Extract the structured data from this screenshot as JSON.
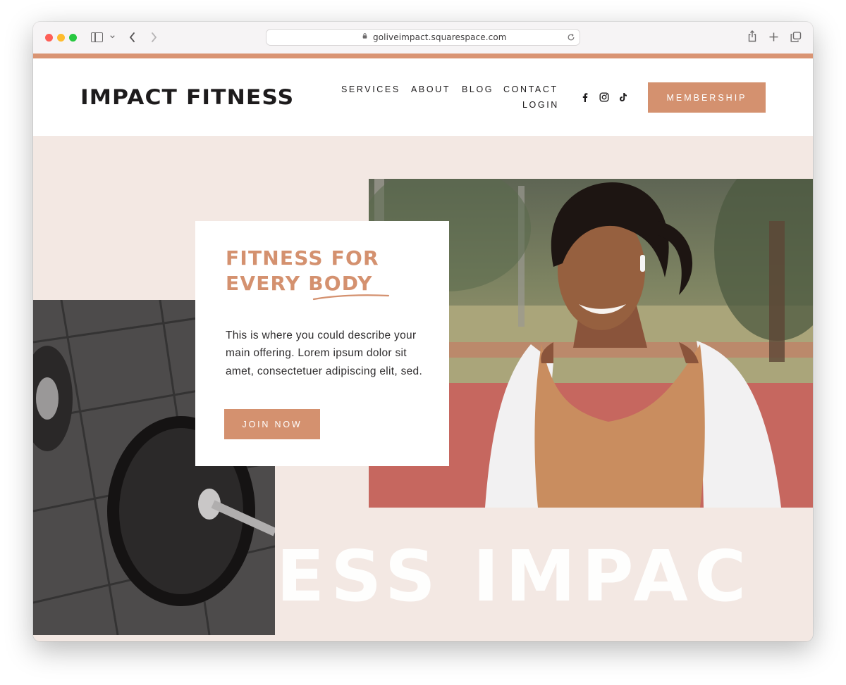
{
  "browser": {
    "url": "goliveimpact.squarespace.com"
  },
  "header": {
    "logo": "IMPACT FITNESS",
    "nav": [
      "SERVICES",
      "ABOUT",
      "BLOG",
      "CONTACT",
      "LOGIN"
    ],
    "social_icons": [
      "facebook-icon",
      "instagram-icon",
      "tiktok-icon"
    ],
    "membership_label": "MEMBERSHIP"
  },
  "hero": {
    "headline_line1": "FITNESS FOR",
    "headline_line2_a": "EVERY ",
    "headline_line2_b": "BODY",
    "description": "This is where you could describe your main offering. Lorem ipsum dolor sit amet, consectetuer adipiscing elit, sed.",
    "cta_label": "JOIN NOW",
    "background_text": "ESS IMPAC"
  },
  "colors": {
    "accent": "#d4916f",
    "hero_background": "#f3e8e3",
    "text_dark": "#1d1b1c"
  }
}
